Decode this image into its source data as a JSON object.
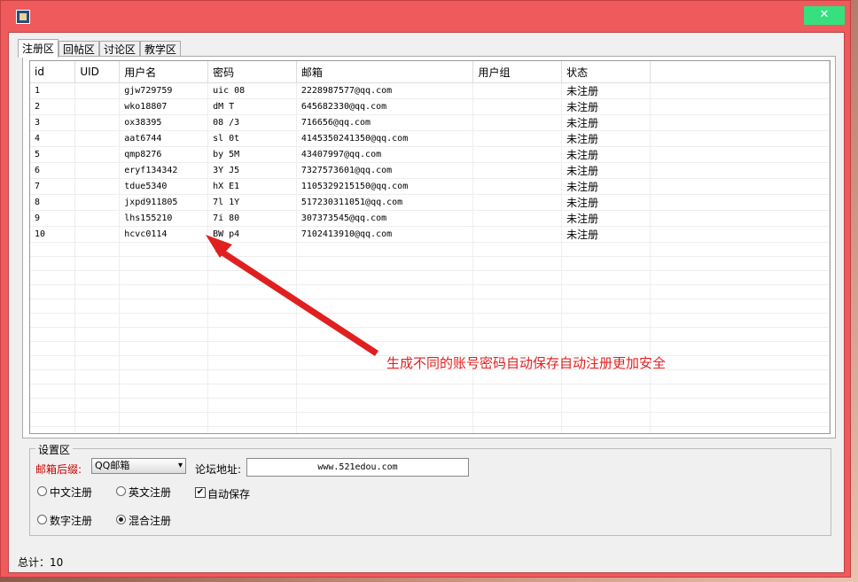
{
  "window": {
    "close_label": "✕",
    "app_icon": "app-icon"
  },
  "tabs": [
    {
      "label": "注册区",
      "active": true
    },
    {
      "label": "回帖区",
      "active": false
    },
    {
      "label": "讨论区",
      "active": false
    },
    {
      "label": "教学区",
      "active": false
    }
  ],
  "table": {
    "headers": [
      "id",
      "UID",
      "用户名",
      "密码",
      "邮箱",
      "用户组",
      "状态"
    ],
    "rows": [
      [
        "1",
        "",
        "gjw729759",
        "uic 08",
        "2228987577@qq.com",
        "",
        "未注册"
      ],
      [
        "2",
        "",
        "wko18807",
        "dM  T",
        "645682330@qq.com",
        "",
        "未注册"
      ],
      [
        "3",
        "",
        "ox38395",
        "08  /3",
        "716656@qq.com",
        "",
        "未注册"
      ],
      [
        "4",
        "",
        "aat6744",
        "sl  0t",
        "4145350241350@qq.com",
        "",
        "未注册"
      ],
      [
        "5",
        "",
        "qmp8276",
        "by  5M",
        "43407997@qq.com",
        "",
        "未注册"
      ],
      [
        "6",
        "",
        "eryf134342",
        "3Y  J5",
        "7327573601@qq.com",
        "",
        "未注册"
      ],
      [
        "7",
        "",
        "tdue5340",
        "hX  E1",
        "1105329215150@qq.com",
        "",
        "未注册"
      ],
      [
        "8",
        "",
        "jxpd911805",
        "7l  1Y",
        "517230311051@qq.com",
        "",
        "未注册"
      ],
      [
        "9",
        "",
        "lhs155210",
        "7i  80",
        "307373545@qq.com",
        "",
        "未注册"
      ],
      [
        "10",
        "",
        "hcvc0114",
        "BW  p4",
        "7102413910@qq.com",
        "",
        "未注册"
      ]
    ]
  },
  "annotation": "生成不同的账号密码自动保存自动注册更加安全",
  "settings": {
    "title": "设置区",
    "email_suffix_label": "邮箱后缀:",
    "email_suffix_value": "QQ邮箱",
    "forum_label": "论坛地址:",
    "forum_value": "www.521edou.com",
    "radio_chinese": "中文注册",
    "radio_english": "英文注册",
    "radio_number": "数字注册",
    "radio_mixed": "混合注册",
    "auto_save": "自动保存",
    "selected_mode": "混合注册",
    "auto_save_checked": true
  },
  "status": {
    "total_label": "总计：10"
  },
  "colors": {
    "title_bar": "#ef5a5c",
    "close_button": "#36e07f",
    "annotation": "#e02020"
  }
}
